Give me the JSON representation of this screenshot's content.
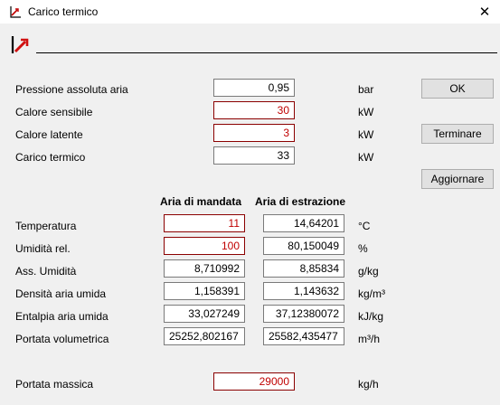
{
  "window": {
    "title": "Carico termico",
    "close": "✕"
  },
  "rows": [
    {
      "label": "Pressione assoluta aria",
      "value": "0,95",
      "unit": "bar"
    },
    {
      "label": "Calore sensibile",
      "value": "30",
      "unit": "kW"
    },
    {
      "label": "Calore latente",
      "value": "3",
      "unit": "kW"
    },
    {
      "label": "Carico termico",
      "value": "33",
      "unit": "kW"
    }
  ],
  "buttons": {
    "ok": "OK",
    "terminare": "Terminare",
    "aggiornare": "Aggiornare"
  },
  "table": {
    "col_supply": "Aria di mandata",
    "col_extract": "Aria di estrazione",
    "rows": [
      {
        "label": "Temperatura",
        "supply": "11",
        "extract": "14,64201",
        "unit": "°C"
      },
      {
        "label": "Umidità rel.",
        "supply": "100",
        "extract": "80,150049",
        "unit": "%"
      },
      {
        "label": "Ass. Umidità",
        "supply": "8,710992",
        "extract": "8,85834",
        "unit": "g/kg"
      },
      {
        "label": "Densità aria umida",
        "supply": "1,158391",
        "extract": "1,143632",
        "unit": "kg/m³"
      },
      {
        "label": "Entalpia aria umida",
        "supply": "33,027249",
        "extract": "37,12380072",
        "unit": "kJ/kg"
      },
      {
        "label": "Portata volumetrica",
        "supply": "25252,802167",
        "extract": "25582,435477",
        "unit": "m³/h"
      }
    ]
  },
  "mass_flow": {
    "label": "Portata massica",
    "value": "29000",
    "unit": "kg/h"
  },
  "colors": {
    "input_text": "#c00000",
    "input_border": "#8b0000"
  }
}
